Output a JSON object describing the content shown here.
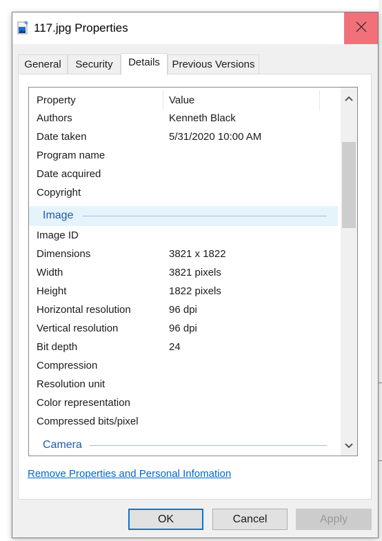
{
  "window": {
    "title": "117.jpg Properties",
    "title_icon": "image-file-icon",
    "close_icon": "close-icon"
  },
  "tabs": [
    {
      "label": "General",
      "active": false
    },
    {
      "label": "Security",
      "active": false
    },
    {
      "label": "Details",
      "active": true
    },
    {
      "label": "Previous Versions",
      "active": false
    }
  ],
  "details": {
    "columns": {
      "property": "Property",
      "value": "Value"
    },
    "rows_top": [
      {
        "property": "Authors",
        "value": "Kenneth Black"
      },
      {
        "property": "Date taken",
        "value": "5/31/2020 10:00 AM"
      },
      {
        "property": "Program name",
        "value": ""
      },
      {
        "property": "Date acquired",
        "value": ""
      },
      {
        "property": "Copyright",
        "value": ""
      }
    ],
    "group_image": "Image",
    "rows_image": [
      {
        "property": "Image ID",
        "value": ""
      },
      {
        "property": "Dimensions",
        "value": "3821 x 1822"
      },
      {
        "property": "Width",
        "value": "3821 pixels"
      },
      {
        "property": "Height",
        "value": "1822 pixels"
      },
      {
        "property": "Horizontal resolution",
        "value": "96 dpi"
      },
      {
        "property": "Vertical resolution",
        "value": "96 dpi"
      },
      {
        "property": "Bit depth",
        "value": "24"
      },
      {
        "property": "Compression",
        "value": ""
      },
      {
        "property": "Resolution unit",
        "value": ""
      },
      {
        "property": "Color representation",
        "value": ""
      },
      {
        "property": "Compressed bits/pixel",
        "value": ""
      }
    ],
    "group_camera": "Camera",
    "scroll_up_icon": "chevron-up-icon",
    "scroll_down_icon": "chevron-down-icon"
  },
  "remove_link": "Remove Properties and Personal Infomation",
  "buttons": {
    "ok": "OK",
    "cancel": "Cancel",
    "apply": "Apply"
  },
  "colors": {
    "close_hover": "#f1707a",
    "group_text": "#1e5aa8",
    "group_highlight": "#e5f3fb",
    "link": "#0066cc",
    "ok_border": "#0078d7"
  }
}
